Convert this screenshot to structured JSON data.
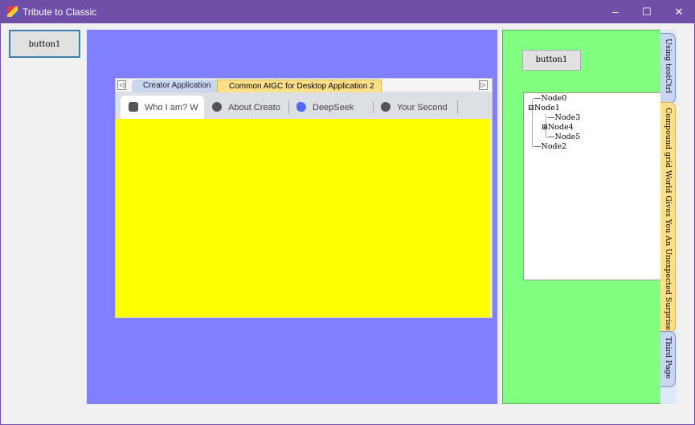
{
  "window": {
    "title": "Tribute to Classic",
    "minimize": "–",
    "maximize": "☐",
    "close": "✕"
  },
  "left_button": "button1",
  "doc_tabs": {
    "scroll_left": "◁",
    "scroll_right": "▷",
    "tabs": [
      "Creator Application",
      "Common AIGC for Desktop Application 2"
    ]
  },
  "browser_tabs": [
    "Who I am? W",
    "About Creato",
    "DeepSeek",
    "Your Second"
  ],
  "right_panel": {
    "button": "button1",
    "tree": {
      "nodes": [
        "Node0",
        "Node1",
        "Node3",
        "Node4",
        "Node5",
        "Node2"
      ],
      "expand_minus": "⊟",
      "expand_plus": "⊞"
    }
  },
  "vertical_tabs": [
    "Using testCtrl",
    "Compound grid World Gives You An Unexpected Surprise",
    "Third Page"
  ],
  "colors": {
    "titlebar": "#6f4fa8",
    "blue_panel": "#8080ff",
    "green_panel": "#80ff80",
    "yellow_content": "#ffff00",
    "selected_tab": "#ffe08a"
  }
}
